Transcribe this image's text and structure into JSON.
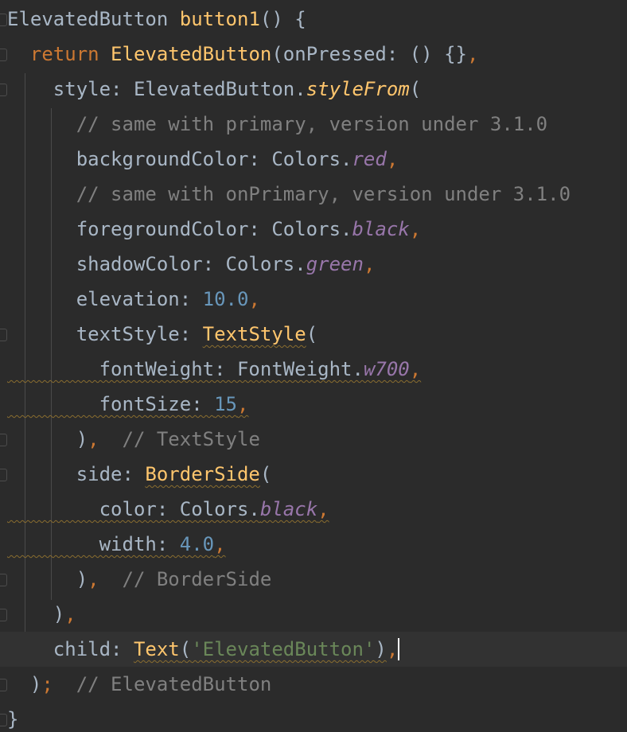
{
  "editor": {
    "lines": [
      {
        "tokens": [
          {
            "t": "ElevatedButton ",
            "c": "plain"
          },
          {
            "t": "button1",
            "c": "fn"
          },
          {
            "t": "() {",
            "c": "plain"
          }
        ]
      },
      {
        "tokens": [
          {
            "t": "  return ",
            "c": "kw"
          },
          {
            "t": "ElevatedButton",
            "c": "fn"
          },
          {
            "t": "(onPressed: () {}",
            "c": "plain"
          },
          {
            "t": ",",
            "c": "orange"
          }
        ]
      },
      {
        "tokens": [
          {
            "t": "    style: ElevatedButton.",
            "c": "plain"
          },
          {
            "t": "styleFrom",
            "c": "method-italic"
          },
          {
            "t": "(",
            "c": "plain"
          }
        ]
      },
      {
        "tokens": [
          {
            "t": "      // same with primary, version under 3.1.0",
            "c": "comment"
          }
        ]
      },
      {
        "tokens": [
          {
            "t": "      backgroundColor: Colors.",
            "c": "plain"
          },
          {
            "t": "red",
            "c": "static"
          },
          {
            "t": ",",
            "c": "orange"
          }
        ]
      },
      {
        "tokens": [
          {
            "t": "      // same with onPrimary, version under 3.1.0",
            "c": "comment"
          }
        ]
      },
      {
        "tokens": [
          {
            "t": "      foregroundColor: Colors.",
            "c": "plain"
          },
          {
            "t": "black",
            "c": "static"
          },
          {
            "t": ",",
            "c": "orange"
          }
        ]
      },
      {
        "tokens": [
          {
            "t": "      shadowColor: Colors.",
            "c": "plain"
          },
          {
            "t": "green",
            "c": "static"
          },
          {
            "t": ",",
            "c": "orange"
          }
        ]
      },
      {
        "tokens": [
          {
            "t": "      elevation: ",
            "c": "plain"
          },
          {
            "t": "10.0",
            "c": "num"
          },
          {
            "t": ",",
            "c": "orange"
          }
        ]
      },
      {
        "tokens": [
          {
            "t": "      textStyle: ",
            "c": "plain"
          },
          {
            "t": "TextStyle",
            "c": "fn squiggle"
          },
          {
            "t": "(",
            "c": "plain"
          }
        ]
      },
      {
        "tokens": [
          {
            "t": "        fontWeight: FontWeight.",
            "c": "plain squiggle"
          },
          {
            "t": "w700",
            "c": "static squiggle"
          },
          {
            "t": ",",
            "c": "orange squiggle"
          }
        ]
      },
      {
        "tokens": [
          {
            "t": "        fontSize: ",
            "c": "plain squiggle"
          },
          {
            "t": "15",
            "c": "num squiggle"
          },
          {
            "t": ",",
            "c": "orange squiggle"
          }
        ]
      },
      {
        "tokens": [
          {
            "t": "      )",
            "c": "plain"
          },
          {
            "t": ",",
            "c": "orange"
          },
          {
            "t": "  // TextStyle",
            "c": "comment"
          }
        ]
      },
      {
        "tokens": [
          {
            "t": "      side: ",
            "c": "plain"
          },
          {
            "t": "BorderSide",
            "c": "fn squiggle"
          },
          {
            "t": "(",
            "c": "plain"
          }
        ]
      },
      {
        "tokens": [
          {
            "t": "        color: Colors.",
            "c": "plain squiggle"
          },
          {
            "t": "black",
            "c": "static squiggle"
          },
          {
            "t": ",",
            "c": "orange squiggle"
          }
        ]
      },
      {
        "tokens": [
          {
            "t": "        width: ",
            "c": "plain squiggle"
          },
          {
            "t": "4.0",
            "c": "num squiggle"
          },
          {
            "t": ",",
            "c": "orange squiggle"
          }
        ]
      },
      {
        "tokens": [
          {
            "t": "      )",
            "c": "plain"
          },
          {
            "t": ",",
            "c": "orange"
          },
          {
            "t": "  // BorderSide",
            "c": "comment"
          }
        ]
      },
      {
        "tokens": [
          {
            "t": "    )",
            "c": "plain"
          },
          {
            "t": ",",
            "c": "orange"
          }
        ]
      },
      {
        "tokens": [
          {
            "t": "    child: ",
            "c": "plain"
          },
          {
            "t": "Text",
            "c": "fn squiggle"
          },
          {
            "t": "(",
            "c": "plain squiggle"
          },
          {
            "t": "'ElevatedButton'",
            "c": "str squiggle"
          },
          {
            "t": ")",
            "c": "plain squiggle"
          },
          {
            "t": ",",
            "c": "orange"
          }
        ]
      },
      {
        "tokens": [
          {
            "t": "  )",
            "c": "plain"
          },
          {
            "t": ";",
            "c": "orange"
          },
          {
            "t": "  // ElevatedButton",
            "c": "comment"
          }
        ]
      },
      {
        "tokens": [
          {
            "t": "}",
            "c": "plain"
          }
        ]
      }
    ],
    "current_line": 18
  }
}
